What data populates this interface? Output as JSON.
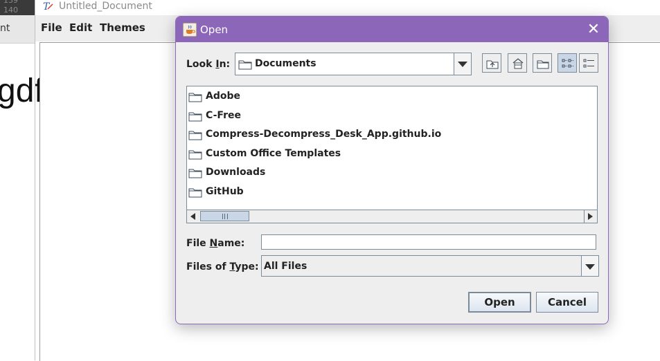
{
  "background": {
    "left_line_numbers": [
      "139",
      "140"
    ],
    "left_menu_fragment": "nt",
    "left_text_fragment": "gdf",
    "editor_title": "Untitled_Document",
    "editor_menu": [
      "File",
      "Edit",
      "Themes"
    ]
  },
  "dialog": {
    "title": "Open",
    "close_glyph": "✕",
    "accent_color": "#8c66b9",
    "look_in_label": "Look In:",
    "look_in_value": "Documents",
    "toolbar_icons": [
      "up-folder-icon",
      "home-icon",
      "new-folder-icon",
      "list-view-icon",
      "details-view-icon"
    ],
    "files": [
      {
        "name": "Adobe",
        "icon": "folder-icon"
      },
      {
        "name": "C-Free",
        "icon": "folder-icon"
      },
      {
        "name": "Compress-Decompress_Desk_App.github.io",
        "icon": "folder-icon"
      },
      {
        "name": "Custom Office Templates",
        "icon": "folder-icon"
      },
      {
        "name": "Downloads",
        "icon": "folder-icon"
      },
      {
        "name": "GitHub",
        "icon": "folder-icon"
      }
    ],
    "file_name_label": "File Name:",
    "file_name_value": "",
    "files_of_type_label": "Files of Type:",
    "files_of_type_value": "All Files",
    "open_button": "Open",
    "cancel_button": "Cancel"
  }
}
